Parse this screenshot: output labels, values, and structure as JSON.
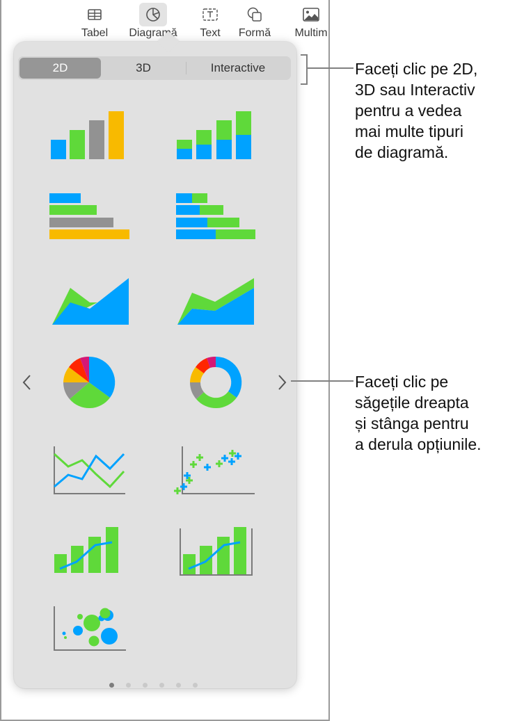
{
  "toolbar": {
    "items": [
      {
        "label": "Tabel",
        "icon": "table-icon"
      },
      {
        "label": "Diagramă",
        "icon": "chart-icon",
        "active": true
      },
      {
        "label": "Text",
        "icon": "text-box-icon"
      },
      {
        "label": "Formă",
        "icon": "shape-icon"
      },
      {
        "label": "Multim",
        "icon": "media-icon"
      }
    ]
  },
  "chart_picker": {
    "segments": [
      {
        "label": "2D",
        "selected": true
      },
      {
        "label": "3D",
        "selected": false
      },
      {
        "label": "Interactive",
        "selected": false
      }
    ],
    "chart_types": [
      "column",
      "stacked-column",
      "bar",
      "stacked-bar",
      "area",
      "stacked-area",
      "pie",
      "donut",
      "line",
      "scatter",
      "mixed",
      "two-axis",
      "bubble"
    ],
    "page_count": 6,
    "current_page": 1,
    "prev_label": "‹",
    "next_label": "›"
  },
  "colors": {
    "blue": "#00a2ff",
    "green": "#5fd93a",
    "gray": "#929292",
    "yellow": "#f8ba00",
    "red": "#ff2600",
    "magenta": "#d41876",
    "axis": "#7a7a7a"
  },
  "callouts": [
    {
      "lines": [
        "Faceți clic pe 2D,",
        "3D sau Interactiv",
        "pentru a vedea",
        "mai multe tipuri",
        "de diagramă."
      ]
    },
    {
      "lines": [
        "Faceți clic pe",
        "săgețile dreapta",
        "și stânga pentru",
        "a derula opțiunile."
      ]
    }
  ]
}
